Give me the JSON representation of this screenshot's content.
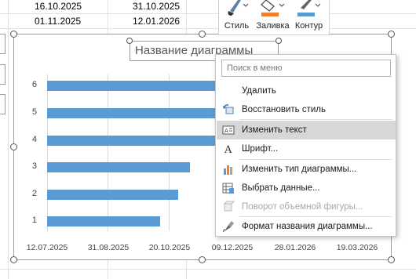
{
  "sheet": {
    "rows": [
      {
        "col1": "16.10.2025",
        "col2": "31.10.2025"
      },
      {
        "col1": "01.11.2025",
        "col2": "12.01.2026"
      }
    ]
  },
  "toolbar": {
    "items": [
      {
        "label": "Стиль",
        "icon": "brush-icon"
      },
      {
        "label": "Заливка",
        "icon": "fill-bucket-icon"
      },
      {
        "label": "Контур",
        "icon": "outline-pen-icon"
      }
    ],
    "colors": {
      "fill": "#ed7d31",
      "outline": "#5b9bd5"
    }
  },
  "chart": {
    "title": "Название диаграммы",
    "bar_color": "#5b9bd5"
  },
  "chart_data": {
    "type": "bar",
    "orientation": "horizontal",
    "title": "Название диаграммы",
    "categories": [
      "1",
      "2",
      "3",
      "4",
      "5",
      "6"
    ],
    "x_ticks": [
      "12.07.2025",
      "31.08.2025",
      "20.10.2025",
      "09.12.2025",
      "28.01.2026",
      "19.03.2026"
    ],
    "xlim": [
      "12.07.2025",
      "19.03.2026"
    ],
    "series": [
      {
        "values": [
          "11.10.2025",
          "26.10.2025",
          "04.11.2025",
          "unknown",
          "unknown",
          "unknown"
        ]
      }
    ],
    "grid": true
  },
  "context_menu": {
    "search_placeholder": "Поиск в меню",
    "items": [
      {
        "label": "Удалить",
        "icon": "",
        "state": "normal"
      },
      {
        "label": "Восстановить стиль",
        "icon": "reset-style-icon",
        "state": "normal"
      },
      {
        "label": "Изменить текст",
        "icon": "edit-text-icon",
        "state": "selected"
      },
      {
        "label": "Шрифт...",
        "icon": "font-icon",
        "state": "normal"
      },
      {
        "label": "Изменить тип диаграммы...",
        "icon": "chart-type-icon",
        "state": "normal"
      },
      {
        "label": "Выбрать данные...",
        "icon": "select-data-icon",
        "state": "normal"
      },
      {
        "label": "Поворот объемной фигуры...",
        "icon": "3d-rotation-icon",
        "state": "disabled"
      },
      {
        "label": "Формат названия диаграммы...",
        "icon": "format-icon",
        "state": "normal"
      }
    ]
  }
}
